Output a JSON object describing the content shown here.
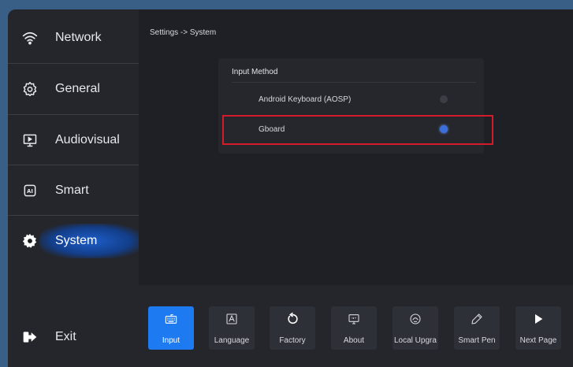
{
  "sidebar": {
    "items": [
      {
        "label": "Network",
        "icon": "wifi-icon"
      },
      {
        "label": "General",
        "icon": "gear-icon"
      },
      {
        "label": "Audiovisual",
        "icon": "monitor-icon"
      },
      {
        "label": "Smart",
        "icon": "ai-chip-icon"
      },
      {
        "label": "System",
        "icon": "system-gear-icon",
        "active": true
      }
    ],
    "exit_label": "Exit"
  },
  "breadcrumb": "Settings -> System",
  "input_method": {
    "title": "Input Method",
    "options": [
      {
        "label": "Android Keyboard (AOSP)",
        "selected": false
      },
      {
        "label": "Gboard",
        "selected": true
      }
    ]
  },
  "toolbar": {
    "buttons": [
      {
        "label": "Input",
        "icon": "keyboard-icon",
        "active": true
      },
      {
        "label": "Language",
        "icon": "language-icon"
      },
      {
        "label": "Factory",
        "icon": "reset-icon"
      },
      {
        "label": "About",
        "icon": "about-monitor-icon"
      },
      {
        "label": "Local Upgrade",
        "icon": "upgrade-icon"
      },
      {
        "label": "Smart Pen",
        "icon": "pen-icon"
      },
      {
        "label": "Next Page",
        "icon": "play-icon"
      }
    ]
  },
  "colors": {
    "accent": "#1e7af0",
    "highlight_border": "#d21b2b",
    "selected_radio": "#3b6fdc"
  }
}
